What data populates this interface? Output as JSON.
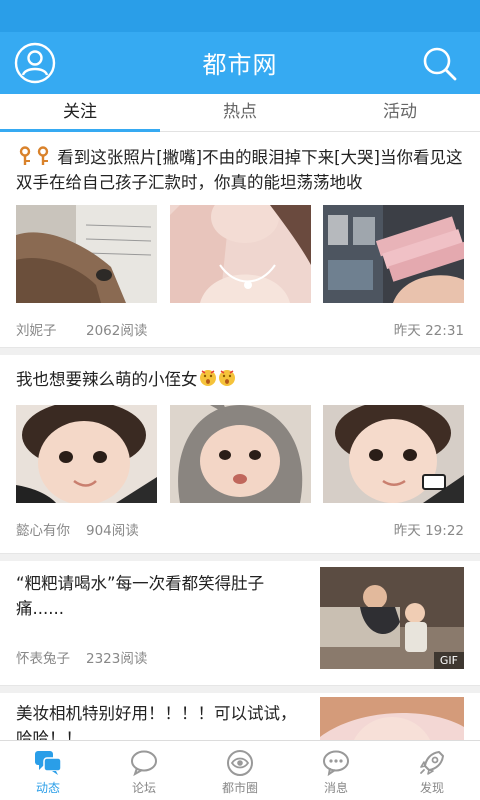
{
  "header": {
    "title": "都市网"
  },
  "tabs": [
    {
      "label": "关注",
      "active": true
    },
    {
      "label": "热点",
      "active": false
    },
    {
      "label": "活动",
      "active": false
    }
  ],
  "feed": [
    {
      "title": "看到这张照片[撇嘴]不由的眼泪掉下来[大哭]当你看见这双手在给自己孩子汇款时，你真的能坦荡荡地收",
      "leading_icons": [
        "key-icon",
        "key-icon"
      ],
      "images": [
        "old-hands-photo",
        "woman-necklace-photo",
        "money-in-hand-photo"
      ],
      "author": "刘妮子",
      "reads": "2062阅读",
      "time": "昨天 22:31"
    },
    {
      "title": "我也想要辣么萌的小侄女",
      "trailing_icons": [
        "emoji-icon",
        "emoji-icon"
      ],
      "images": [
        "baby-photo-1",
        "baby-hood-photo",
        "baby-photo-2"
      ],
      "author": "懿心有你",
      "reads": "904阅读",
      "time": "昨天 19:22"
    },
    {
      "title": "“粑粑请喝水”每一次看都笑得肚子痛......",
      "images": [
        "father-child-gif"
      ],
      "badge": "GIF",
      "author": "怀表兔子",
      "reads": "2323阅读"
    },
    {
      "title": "美妆相机特别好用！！！！可以试试，哈哈！！",
      "images": [
        "selfie-photo"
      ]
    }
  ],
  "bottom_nav": [
    {
      "label": "动态",
      "icon": "chat-bubbles-icon",
      "active": true
    },
    {
      "label": "论坛",
      "icon": "speech-bubble-icon",
      "active": false
    },
    {
      "label": "都市圈",
      "icon": "eye-circle-icon",
      "active": false
    },
    {
      "label": "消息",
      "icon": "message-dots-icon",
      "active": false
    },
    {
      "label": "发现",
      "icon": "rocket-icon",
      "active": false
    }
  ],
  "colors": {
    "primary": "#36aaf2",
    "status_bar": "#2a9ee8",
    "muted_text": "#888888"
  }
}
